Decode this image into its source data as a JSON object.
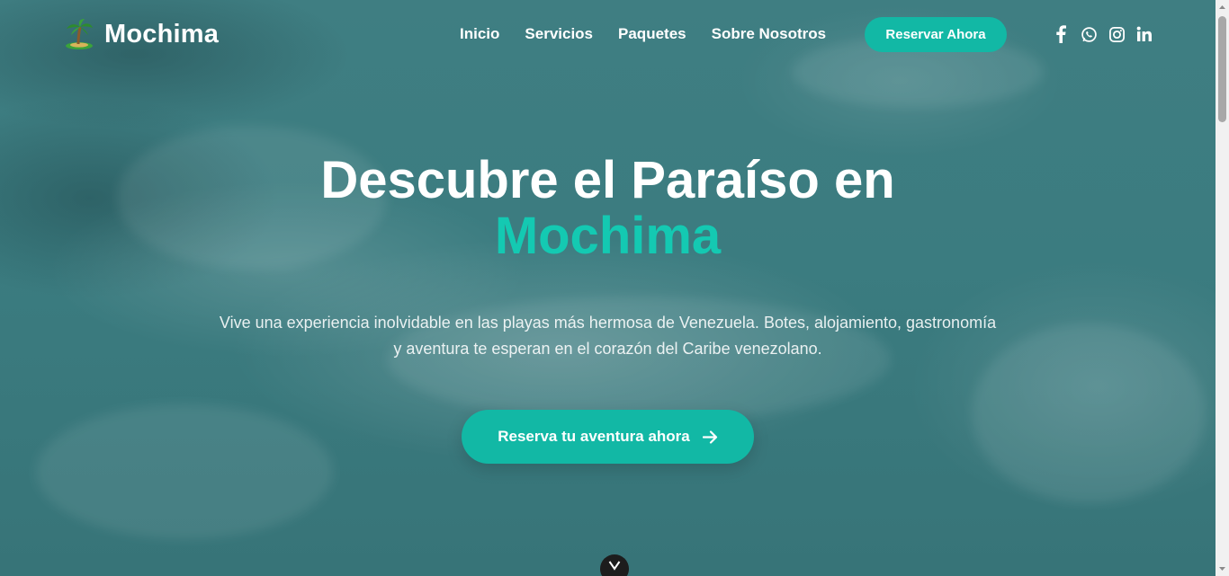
{
  "brand": {
    "name": "Mochima",
    "icon": "palm-island-icon"
  },
  "nav": {
    "items": [
      {
        "label": "Inicio"
      },
      {
        "label": "Servicios"
      },
      {
        "label": "Paquetes"
      },
      {
        "label": "Sobre Nosotros"
      }
    ],
    "cta_label": "Reservar Ahora"
  },
  "social": [
    {
      "icon": "facebook-icon"
    },
    {
      "icon": "whatsapp-icon"
    },
    {
      "icon": "instagram-icon"
    },
    {
      "icon": "linkedin-icon"
    }
  ],
  "hero": {
    "title_line1": "Descubre el Paraíso en",
    "title_accent": "Mochima",
    "subtitle": "Vive una experiencia inolvidable en las playas más hermosa de Venezuela. Botes, alojamiento, gastronomía y aventura te esperan en el corazón del Caribe venezolano.",
    "cta_label": "Reserva tu aventura ahora",
    "cta_icon": "arrow-right-icon",
    "scroll_icon": "chevron-down-icon"
  },
  "colors": {
    "accent": "#12b8a5",
    "accent_text": "#14c9b2",
    "ocean": "#3b7c80"
  }
}
